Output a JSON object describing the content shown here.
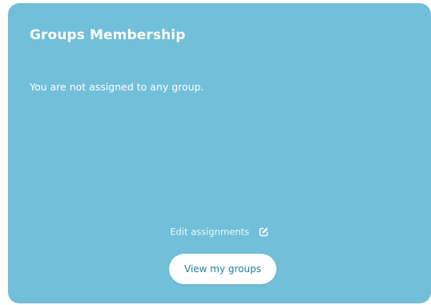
{
  "card": {
    "title": "Groups Membership",
    "message": "You are not assigned to any group.",
    "edit_link_label": "Edit assignments",
    "edit_icon": "pencil-square-icon",
    "view_button_label": "View my groups"
  },
  "colors": {
    "card_background": "#71bfd8",
    "text": "#ffffff",
    "button_background": "#ffffff",
    "button_text": "#1c7fa0"
  }
}
